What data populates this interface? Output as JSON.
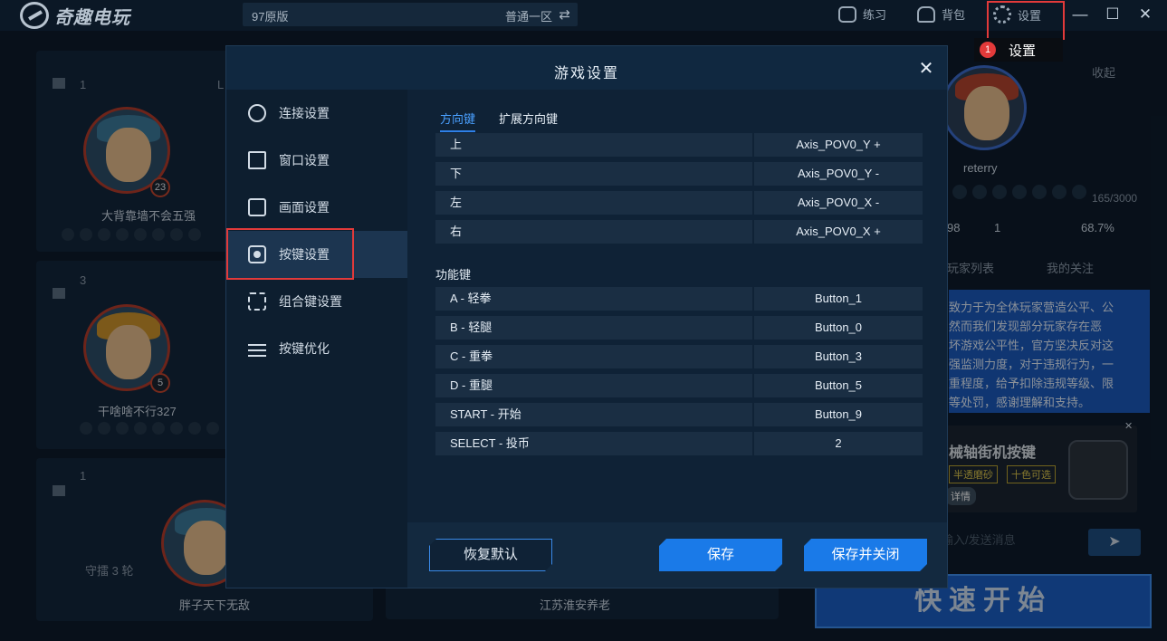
{
  "app": {
    "logo_text": "奇趣电玩"
  },
  "server": {
    "name": "97原版",
    "zone": "普通一区",
    "swap_icon": "⇄"
  },
  "topbar": {
    "practice": "练习",
    "backpack": "背包",
    "settings": "设置"
  },
  "window_controls": {
    "minimize": "—",
    "maximize": "☐",
    "close": "✕"
  },
  "tooltip": {
    "badge": "1",
    "text": "设置"
  },
  "lobby": {
    "seats": [
      {
        "num": "1",
        "player": "大背靠墙不会五强",
        "level": "23",
        "extra": "L"
      },
      {
        "num": "3",
        "player": "干啥啥不行327",
        "level": "5"
      },
      {
        "num": "1",
        "status": "守擂 3 轮",
        "player": "胖子天下无敌"
      }
    ],
    "bottom_player_2": "江苏淮安养老"
  },
  "side_panel": {
    "collapse": "收起",
    "username": "reterry",
    "exp": "165/3000",
    "stat1": "98",
    "stat2": "1",
    "stat3": "68.7%",
    "tab_players": "玩家列表",
    "tab_follow": "我的关注",
    "notice": "致力于为全体玩家营造公平、公\n然而我们发现部分玩家存在恶\n坏游戏公平性，官方坚决反对这\n强监测力度，对于违规行为，一\n重程度，给予扣除违规等级、限\n等处罚，感谢理解和支持。",
    "ad_title": "械轴街机按键",
    "ad_tag1": "半透磨砂",
    "ad_tag2": "十色可选",
    "ad_btn": "详情",
    "chat_placeholder": "输入/发送消息",
    "quick_start": "快速开始"
  },
  "modal": {
    "title": "游戏设置",
    "close": "✕",
    "nav": [
      {
        "label": "连接设置",
        "icon": "globe-icon"
      },
      {
        "label": "窗口设置",
        "icon": "window-icon"
      },
      {
        "label": "画面设置",
        "icon": "monitor-icon"
      },
      {
        "label": "按键设置",
        "icon": "key-icon"
      },
      {
        "label": "组合键设置",
        "icon": "combo-icon"
      },
      {
        "label": "按键优化",
        "icon": "sliders-icon"
      }
    ],
    "tabs": [
      {
        "label": "方向键"
      },
      {
        "label": "扩展方向键"
      }
    ],
    "direction_keys": [
      {
        "name": "上",
        "value": "Axis_POV0_Y +"
      },
      {
        "name": "下",
        "value": "Axis_POV0_Y -"
      },
      {
        "name": "左",
        "value": "Axis_POV0_X -"
      },
      {
        "name": "右",
        "value": "Axis_POV0_X +"
      }
    ],
    "function_label": "功能键",
    "function_keys": [
      {
        "name": "A - 轻拳",
        "value": "Button_1"
      },
      {
        "name": "B - 轻腿",
        "value": "Button_0"
      },
      {
        "name": "C - 重拳",
        "value": "Button_3"
      },
      {
        "name": "D - 重腿",
        "value": "Button_5"
      },
      {
        "name": "START - 开始",
        "value": "Button_9"
      },
      {
        "name": "SELECT - 投币",
        "value": "2"
      }
    ],
    "btn_reset": "恢复默认",
    "btn_save": "保存",
    "btn_save_close": "保存并关闭"
  },
  "colors": {
    "accent": "#1a7ae8",
    "highlight": "#e23a3a",
    "panel": "#0f2236"
  }
}
